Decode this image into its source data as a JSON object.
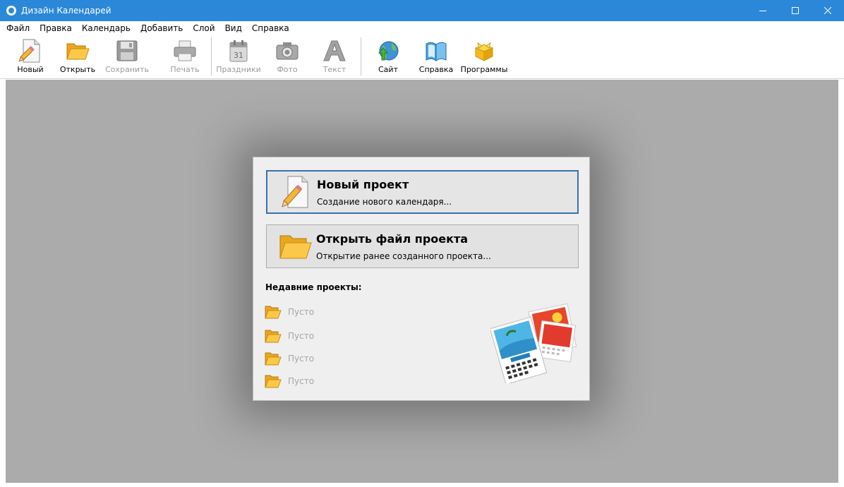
{
  "window": {
    "title": "Дизайн Календарей"
  },
  "menu": [
    "Файл",
    "Правка",
    "Календарь",
    "Добавить",
    "Слой",
    "Вид",
    "Справка"
  ],
  "toolbar": {
    "new": "Новый",
    "open": "Открыть",
    "save": "Сохранить",
    "print": "Печать",
    "holidays": "Праздники",
    "photo": "Фото",
    "text": "Текст",
    "site": "Сайт",
    "help": "Справка",
    "programs": "Программы"
  },
  "dialog": {
    "new_project": {
      "title": "Новый проект",
      "subtitle": "Создание нового календаря..."
    },
    "open_project": {
      "title": "Открыть файл проекта",
      "subtitle": "Открытие ранее созданного проекта..."
    },
    "recent_title": "Недавние проекты:",
    "recent": [
      "Пусто",
      "Пусто",
      "Пусто",
      "Пусто"
    ]
  },
  "colors": {
    "titlebar": "#2b88d8",
    "workspace": "#ababab",
    "focus_border": "#3c6fb4"
  }
}
